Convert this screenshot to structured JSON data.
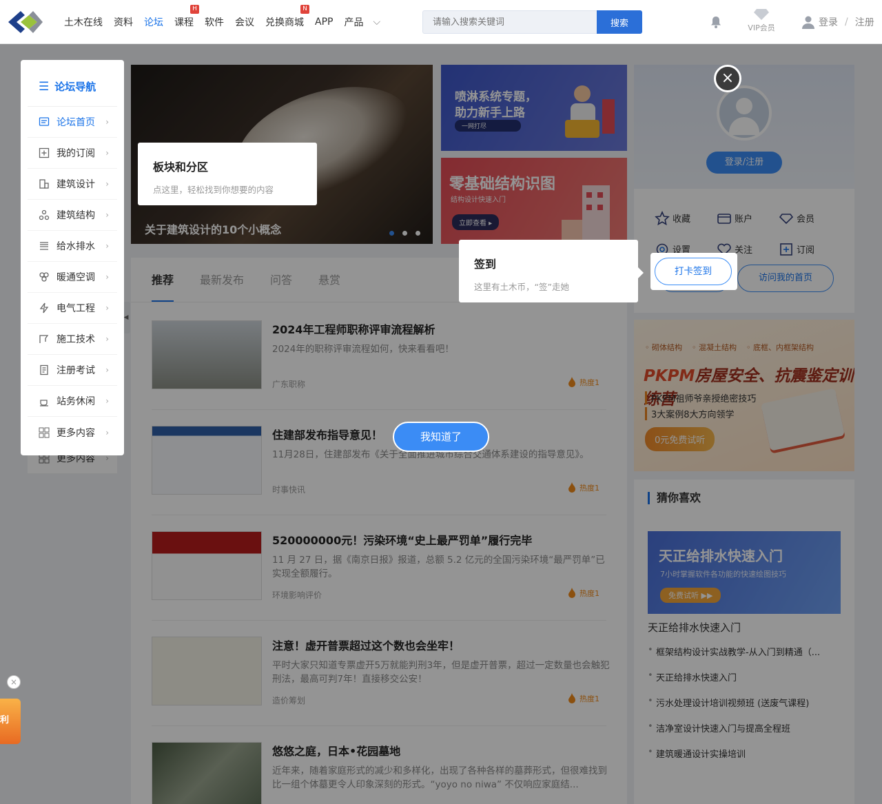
{
  "header": {
    "nav": [
      {
        "label": "土木在线",
        "active": false,
        "badge": ""
      },
      {
        "label": "资料",
        "active": false,
        "badge": ""
      },
      {
        "label": "论坛",
        "active": true,
        "badge": ""
      },
      {
        "label": "课程",
        "active": false,
        "badge": "H"
      },
      {
        "label": "软件",
        "active": false,
        "badge": ""
      },
      {
        "label": "会议",
        "active": false,
        "badge": ""
      },
      {
        "label": "兑换商城",
        "active": false,
        "badge": "N"
      },
      {
        "label": "APP",
        "active": false,
        "badge": ""
      },
      {
        "label": "产品",
        "active": false,
        "badge": ""
      }
    ],
    "search_placeholder": "请输入搜索关键词",
    "search_button": "搜索",
    "vip_label": "VIP会员",
    "login": "登录",
    "sep": "/",
    "register": "注册"
  },
  "sidebar": {
    "title": "论坛导航",
    "items": [
      {
        "label": "论坛首页",
        "icon": "forum-home-icon",
        "active": true
      },
      {
        "label": "我的订阅",
        "icon": "subscribe-icon",
        "active": false
      },
      {
        "label": "建筑设计",
        "icon": "building-design-icon",
        "active": false
      },
      {
        "label": "建筑结构",
        "icon": "structure-icon",
        "active": false
      },
      {
        "label": "给水排水",
        "icon": "water-icon",
        "active": false
      },
      {
        "label": "暖通空调",
        "icon": "hvac-icon",
        "active": false
      },
      {
        "label": "电气工程",
        "icon": "electric-icon",
        "active": false
      },
      {
        "label": "施工技术",
        "icon": "construction-icon",
        "active": false
      },
      {
        "label": "注册考试",
        "icon": "exam-icon",
        "active": false
      },
      {
        "label": "站务休闲",
        "icon": "leisure-icon",
        "active": false
      },
      {
        "label": "更多内容",
        "icon": "grid-icon",
        "active": false
      }
    ],
    "bottom_item": "更多内容"
  },
  "banner": {
    "caption": "关于建筑设计的10个小概念"
  },
  "promos": {
    "p1_title_1": "喷淋系统专题，",
    "p1_title_2": "助力新手上路",
    "p1_tag": "一网打尽",
    "p2_title": "零基础结构识图",
    "p2_sub": "结构设计快速入门",
    "p2_btn": "立即查看 ▸"
  },
  "user_card": {
    "login_button": "登录/注册",
    "quick": [
      "收藏",
      "账户",
      "会员",
      "设置",
      "关注",
      "订阅"
    ],
    "sign_button": "打卡签到",
    "home_button": "访问我的首页"
  },
  "ad": {
    "tags": [
      "◦ 砌体结构",
      "◦ 混凝土结构",
      "◦ 底框、内框架结构"
    ],
    "title_a": "PKPM",
    "title_b": "房屋安全、抗震鉴定训练营",
    "line1": "PKPM祖师爷亲授绝密技巧",
    "line2": "3大案例8大方向领学",
    "cta": "0元免费试听"
  },
  "guess": {
    "title": "猜你喜欢",
    "img_title": "天正给排水快速入门",
    "img_sub": "7小时掌握软件各功能的快速绘图技巧",
    "img_btn": "免费试听 ▶▶",
    "caption": "天正给排水快速入门",
    "items": [
      "框架结构设计实战教学-从入门到精通（...",
      "天正给排水快速入门",
      "污水处理设计培训视频班 (送废气课程)",
      "洁净室设计快速入门与提高全程班",
      "建筑暖通设计实操培训"
    ]
  },
  "feed": {
    "tabs": [
      "推荐",
      "最新发布",
      "问答",
      "悬赏"
    ],
    "posts": [
      {
        "title": "2024年工程师职称评审流程解析",
        "desc": "2024年的职称评审流程如何，快来看看吧！",
        "source": "广东职称",
        "hot": "热度1"
      },
      {
        "title": "住建部发布指导意见！",
        "desc": "11月28日，住建部发布《关于全面推进城市综合交通体系建设的指导意见》。",
        "source": "时事快讯",
        "hot": "热度1"
      },
      {
        "title": "520000000元！污染环境“史上最严罚单”履行完毕",
        "desc": "11 月 27 日，据《南京日报》报道，总额 5.2 亿元的全国污染环境“最严罚单”已实现全额履行。",
        "source": "环境影响评价",
        "hot": "热度1"
      },
      {
        "title": "注意！虚开普票超过这个数也会坐牢！",
        "desc": "平时大家只知道专票虚开5万就能判刑3年，但是虚开普票，超过一定数量也会触犯刑法，最高可判7年！直接移交公安！",
        "source": "造价筹划",
        "hot": "热度1"
      },
      {
        "title": "悠悠之庭，日本•花园墓地",
        "desc": "近年来，随着家庭形式的减少和多样化，出现了各种各样的墓葬形式，但很难找到比一组个体墓更令人印象深刻的形式。“yoyo no niwa” 不仅响应家庭结...",
        "source": "",
        "hot": ""
      }
    ]
  },
  "guide": {
    "tip1_title": "板块和分区",
    "tip1_desc": "点这里，轻松找到你想要的内容",
    "tip2_title": "签到",
    "tip2_desc": "这里有土木币，“签”走她",
    "got_it": "我知道了",
    "close": "×"
  },
  "float_ad": {
    "close": "×",
    "text": "利"
  }
}
